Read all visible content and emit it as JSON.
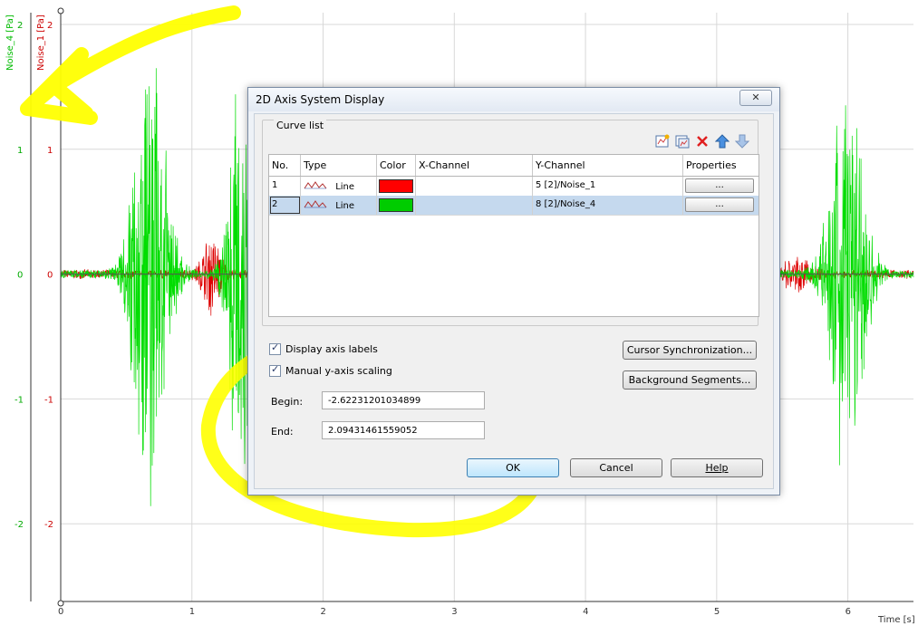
{
  "chart_data": {
    "type": "line",
    "xlabel": "Time [s]",
    "ylabel_left": "Noise_4 [Pa]",
    "ylabel_right": "Noise_1 [Pa]",
    "xlim": [
      0,
      6.5
    ],
    "ylim": [
      -2.62231201034899,
      2.09431461559052
    ],
    "x_ticks": [
      0,
      1,
      2,
      3,
      4,
      5,
      6
    ],
    "y_ticks": [
      -2,
      -1,
      0,
      1,
      2
    ],
    "grid": true,
    "series": [
      {
        "name": "Noise_4",
        "color": "#00dd00",
        "bursts": [
          {
            "center": 0.68,
            "amp": 2.1,
            "width": 0.22
          },
          {
            "center": 1.38,
            "amp": 2.0,
            "width": 0.16
          },
          {
            "center": 2.1,
            "amp": 1.7,
            "width": 0.12
          },
          {
            "center": 4.0,
            "amp": 1.5,
            "width": 0.15
          },
          {
            "center": 6.0,
            "amp": 1.9,
            "width": 0.22
          }
        ]
      },
      {
        "name": "Noise_1",
        "color": "#dd0000",
        "bursts": [
          {
            "center": 1.15,
            "amp": 0.35,
            "width": 0.12
          },
          {
            "center": 5.6,
            "amp": 0.12,
            "width": 0.2
          }
        ]
      }
    ]
  },
  "dialog": {
    "title": "2D Axis System Display",
    "close_glyph": "✕",
    "curve_list_label": "Curve list",
    "toolbar_icons": [
      "new-curve-icon",
      "edit-curve-icon",
      "delete-curve-icon",
      "move-up-icon",
      "move-down-icon"
    ],
    "columns": [
      "No.",
      "Type",
      "Color",
      "X-Channel",
      "Y-Channel",
      "Properties"
    ],
    "rows": [
      {
        "no": "1",
        "type": "Line",
        "color": "#ff0000",
        "x_channel": "",
        "y_channel": "5  [2]/Noise_1",
        "properties": "...",
        "selected": false
      },
      {
        "no": "2",
        "type": "Line",
        "color": "#00cc00",
        "x_channel": "",
        "y_channel": "8  [2]/Noise_4",
        "properties": "...",
        "selected": true
      }
    ],
    "display_axis_labels": {
      "label": "Display axis labels",
      "checked": true
    },
    "manual_scaling": {
      "label": "Manual  y-axis scaling",
      "checked": true
    },
    "begin_label": "Begin:",
    "begin_value": "-2.62231201034899",
    "end_label": "End:",
    "end_value": "2.09431461559052",
    "cursor_sync_button": "Cursor Synchronization...",
    "background_segments_button": "Background Segments...",
    "ok_button": "OK",
    "cancel_button": "Cancel",
    "help_button": "Help"
  },
  "annotation_color": "#ffff00"
}
